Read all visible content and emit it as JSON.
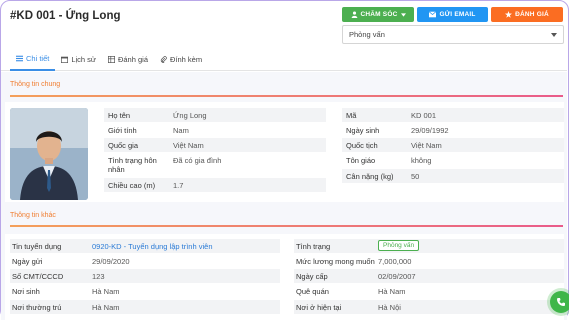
{
  "header": {
    "title": "#KD 001 - Ứng Long"
  },
  "actions": {
    "care_label": "CHĂM SÓC",
    "email_label": "GỬI EMAIL",
    "eval_label": "ĐÁNH GIÁ"
  },
  "stage_select": {
    "value": "Phỏng vấn"
  },
  "tabs": [
    {
      "label": "Chi tiết",
      "icon": "list-icon",
      "active": true
    },
    {
      "label": "Lịch sử",
      "icon": "calendar-icon"
    },
    {
      "label": "Đánh giá",
      "icon": "table-icon"
    },
    {
      "label": "Đính kèm",
      "icon": "paperclip-icon"
    }
  ],
  "general": {
    "title": "Thông tin chung",
    "left": [
      {
        "label": "Họ tên",
        "value": "Ứng Long"
      },
      {
        "label": "Giới tính",
        "value": "Nam"
      },
      {
        "label": "Quốc gia",
        "value": "Việt Nam"
      },
      {
        "label": "Tình trạng hôn nhân",
        "value": "Đã có gia đình"
      },
      {
        "label": "Chiều cao (m)",
        "value": "1.7"
      }
    ],
    "right": [
      {
        "label": "Mã",
        "value": "KD 001"
      },
      {
        "label": "Ngày sinh",
        "value": "29/09/1992"
      },
      {
        "label": "Quốc tịch",
        "value": "Việt Nam"
      },
      {
        "label": "Tôn giáo",
        "value": "không"
      },
      {
        "label": "Cân nặng (kg)",
        "value": "50"
      }
    ]
  },
  "other": {
    "title": "Thông tin khác",
    "left": [
      {
        "label": "Tin tuyển dụng",
        "value": "0920-KD - Tuyển dụng lập trình viên"
      },
      {
        "label": "Ngày gửi",
        "value": "29/09/2020"
      },
      {
        "label": "Số CMT/CCCD",
        "value": "123"
      },
      {
        "label": "Nơi sinh",
        "value": "Hà Nam"
      },
      {
        "label": "Nơi thường trú",
        "value": "Hà Nam"
      }
    ],
    "right": [
      {
        "label": "Tình trạng",
        "value": "Phỏng vấn"
      },
      {
        "label": "Mức lương mong muốn",
        "value": "7,000,000"
      },
      {
        "label": "Ngày cấp",
        "value": "02/09/2007"
      },
      {
        "label": "Quê quán",
        "value": "Hà Nam"
      },
      {
        "label": "Nơi ở hiện tại",
        "value": "Hà Nội"
      }
    ]
  },
  "colors": {
    "care": "#4caf50",
    "email": "#2196f3",
    "eval": "#fb6d22",
    "accent": "#3a8ee6",
    "section_title": "#f07d2f"
  }
}
